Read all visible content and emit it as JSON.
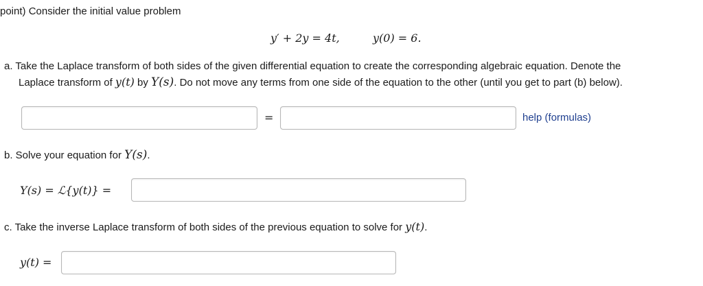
{
  "intro": "point) Consider the initial value problem",
  "ode": {
    "equation": "y′ + 2y = 4t,",
    "initial_condition": "y(0) = 6."
  },
  "part_a": {
    "text_line1": "a. Take the Laplace transform of both sides of the given differential equation to create the corresponding algebraic equation. Denote the",
    "line2_pre": "Laplace transform of ",
    "line2_yt": "y(t)",
    "line2_by": " by ",
    "line2_Ys": "Y(s)",
    "line2_post": ". Do not move any terms from one side of the equation to the other (until you get to part (b) below).",
    "equals": "=",
    "help_link": "help (formulas)",
    "left_input_value": "",
    "right_input_value": ""
  },
  "part_b": {
    "text_pre": "b. Solve your equation for ",
    "text_Ys": "Y(s)",
    "text_post": ".",
    "label": "Y(s) = ℒ{y(t)} =",
    "input_value": ""
  },
  "part_c": {
    "text_pre": "c. Take the inverse Laplace transform of both sides of the previous equation to solve for ",
    "text_yt": "y(t)",
    "text_post": ".",
    "label": "y(t) =",
    "input_value": ""
  }
}
